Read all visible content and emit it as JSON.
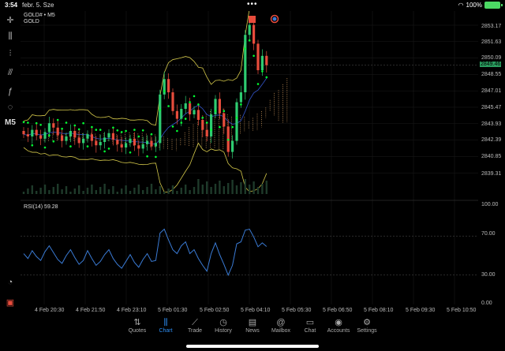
{
  "status": {
    "time": "3:54",
    "date": "febr. 5. Sze",
    "battery": "100%"
  },
  "symbol": {
    "title": "GOLD# • M5",
    "subtitle": "GOLD"
  },
  "rsi_label": "RSI(14) 59.28",
  "price_axis": [
    "2853.17",
    "2851.63",
    "2850.09",
    "2848.55",
    "2847.01",
    "2845.47",
    "2843.93",
    "2842.39",
    "2840.85",
    "2839.31"
  ],
  "current_price": "2849.46",
  "rsi_axis": [
    "100.00",
    "70.00",
    "30.00",
    "0.00"
  ],
  "time_axis": [
    "4 Feb 20:30",
    "4 Feb 21:50",
    "4 Feb 23:10",
    "5 Feb 01:30",
    "5 Feb 02:50",
    "5 Feb 04:10",
    "5 Feb 05:30",
    "5 Feb 06:50",
    "5 Feb 08:10",
    "5 Feb 09:30",
    "5 Feb 10:50"
  ],
  "timeframe": "M5",
  "tabs": [
    {
      "label": "Quotes",
      "icon": "quotes-icon"
    },
    {
      "label": "Chart",
      "icon": "chart-icon"
    },
    {
      "label": "Trade",
      "icon": "trade-icon"
    },
    {
      "label": "History",
      "icon": "history-icon"
    },
    {
      "label": "News",
      "icon": "news-icon"
    },
    {
      "label": "Mailbox",
      "icon": "mailbox-icon"
    },
    {
      "label": "Chat",
      "icon": "chat-icon"
    },
    {
      "label": "Accounts",
      "icon": "accounts-icon"
    },
    {
      "label": "Settings",
      "icon": "settings-icon"
    }
  ],
  "active_tab": "Chart",
  "colors": {
    "bull": "#2ecc71",
    "bear": "#e74c3c",
    "sar": "#00ff33",
    "bands": "#d4c84a",
    "rsi": "#3a7bd5",
    "accent": "#2d8cf0"
  },
  "chart_data": {
    "type": "candlestick",
    "y_range": [
      2838.5,
      2853.5
    ],
    "rsi_range": [
      0,
      100
    ],
    "rsi_levels": [
      70,
      30
    ],
    "closes": [
      2843.2,
      2843.0,
      2843.6,
      2843.1,
      2842.8,
      2843.4,
      2844.2,
      2843.8,
      2843.1,
      2842.6,
      2843.0,
      2843.5,
      2842.9,
      2842.4,
      2842.8,
      2843.2,
      2842.6,
      2842.2,
      2842.5,
      2842.9,
      2843.3,
      2842.7,
      2842.3,
      2842.0,
      2842.4,
      2842.8,
      2842.2,
      2841.9,
      2842.3,
      2842.6,
      2842.1,
      2842.4,
      2846.8,
      2848.2,
      2847.0,
      2845.3,
      2844.6,
      2845.5,
      2846.0,
      2845.0,
      2845.4,
      2844.5,
      2843.6,
      2843.0,
      2845.0,
      2846.4,
      2845.1,
      2843.9,
      2841.6,
      2842.6,
      2846.1,
      2847.0,
      2852.2,
      2853.1,
      2851.4,
      2849.0,
      2850.3,
      2849.46
    ],
    "rsi": [
      52,
      47,
      55,
      49,
      45,
      54,
      60,
      53,
      46,
      42,
      50,
      56,
      48,
      41,
      45,
      55,
      47,
      40,
      44,
      51,
      56,
      47,
      41,
      37,
      44,
      51,
      43,
      38,
      46,
      52,
      44,
      45,
      73,
      77,
      66,
      56,
      52,
      60,
      64,
      52,
      56,
      47,
      40,
      34,
      52,
      63,
      51,
      41,
      30,
      40,
      62,
      64,
      76,
      77,
      69,
      59,
      63,
      59.28
    ]
  }
}
